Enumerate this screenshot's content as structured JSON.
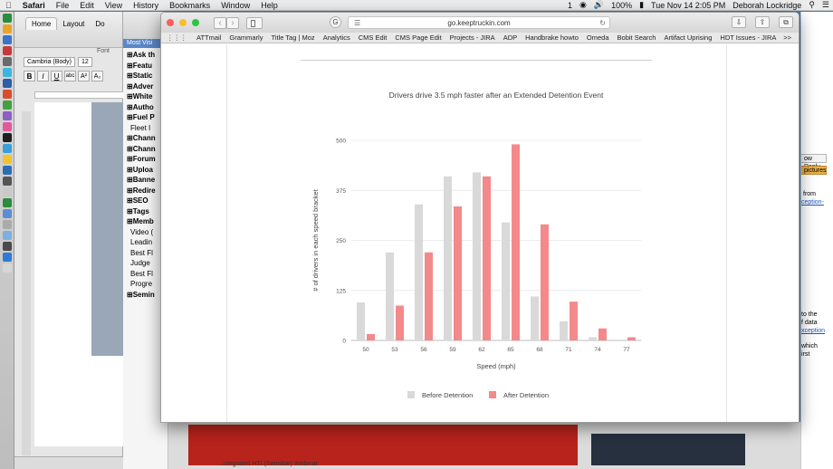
{
  "menubar": {
    "apple": "",
    "app": "Safari",
    "items": [
      "File",
      "Edit",
      "View",
      "History",
      "Bookmarks",
      "Window",
      "Help"
    ],
    "status": {
      "notif": "1",
      "battery": "100%",
      "datetime": "Tue Nov 14  2:05 PM",
      "user": "Deborah Lockridge"
    }
  },
  "word": {
    "tabs": [
      "Home",
      "Layout",
      "Do"
    ],
    "font_group": "Font",
    "font_name": "Cambria (Body)",
    "font_size": "12",
    "format_buttons": [
      "B",
      "I",
      "U",
      "abc",
      "A²",
      "A₂"
    ]
  },
  "midpanel": {
    "most_visited": "Most Visi",
    "tree": [
      {
        "label": "Ask th",
        "bold": true
      },
      {
        "label": "Featu",
        "bold": true
      },
      {
        "label": "Static",
        "bold": true
      },
      {
        "label": "Adver",
        "bold": true
      },
      {
        "label": "White",
        "bold": true
      },
      {
        "label": "Autho",
        "bold": true
      },
      {
        "label": "Fuel P",
        "bold": true
      },
      {
        "label": "Fleet I",
        "bold": false
      },
      {
        "label": "Chann",
        "bold": true
      },
      {
        "label": "Chann",
        "bold": true
      },
      {
        "label": "Forum",
        "bold": true
      },
      {
        "label": "Uploa",
        "bold": true
      },
      {
        "label": "Banne",
        "bold": true
      },
      {
        "label": "Redire",
        "bold": true
      },
      {
        "label": "SEO",
        "bold": true
      },
      {
        "label": "Tags",
        "bold": true
      },
      {
        "label": "Memb",
        "bold": true
      },
      {
        "label": "Video (",
        "bold": false
      },
      {
        "label": "Leadin",
        "bold": false
      },
      {
        "label": "Best Fl",
        "bold": false
      },
      {
        "label": "Judge",
        "bold": false
      },
      {
        "label": "Best Fl",
        "bold": false
      },
      {
        "label": "Progre",
        "bold": false
      },
      {
        "label": "Semin",
        "bold": true
      }
    ]
  },
  "background_right": {
    "reply_button": "ow Reply",
    "pictures_button": "pictures",
    "lines": [
      "from",
      "ception-",
      "to the",
      "f data",
      "xception",
      "which",
      "irst"
    ]
  },
  "background_bottom": {
    "caption": "...ntegrated HTI (Sensible) Webinar"
  },
  "browser": {
    "url": "go.keeptruckin.com",
    "bookmarks": [
      "ATTmail",
      "Grammarly",
      "Title Tag | Moz",
      "Analytics",
      "CMS Edit",
      "CMS Page Edit",
      "Projects - JIRA",
      "ADP",
      "Handbrake howto",
      "Omeda",
      "Bobit Search",
      "Artifact Uprising",
      "HDT Issues - JIRA"
    ],
    "more": ">>"
  },
  "colors": {
    "before": "#d9d9d9",
    "after": "#f4898b",
    "menubar": "#ececec",
    "desktop": "#3b7fb8"
  },
  "chart_data": {
    "type": "bar",
    "title": "Drivers drive 3.5 mph faster after an Extended Detention Event",
    "xlabel": "Speed (mph)",
    "ylabel": "# of drivers in each speed bracket",
    "categories": [
      "50",
      "53",
      "56",
      "59",
      "62",
      "65",
      "68",
      "71",
      "74",
      "77"
    ],
    "ylim": [
      0,
      500
    ],
    "yticks": [
      0,
      125,
      250,
      375,
      500
    ],
    "grid": true,
    "legend_position": "bottom",
    "series": [
      {
        "name": "Before Detention",
        "color": "#d9d9d9",
        "values": [
          95,
          220,
          340,
          410,
          420,
          295,
          110,
          48,
          8,
          0
        ]
      },
      {
        "name": "After Detention",
        "color": "#f4898b",
        "values": [
          16,
          87,
          220,
          335,
          410,
          490,
          290,
          97,
          30,
          8
        ]
      }
    ]
  }
}
